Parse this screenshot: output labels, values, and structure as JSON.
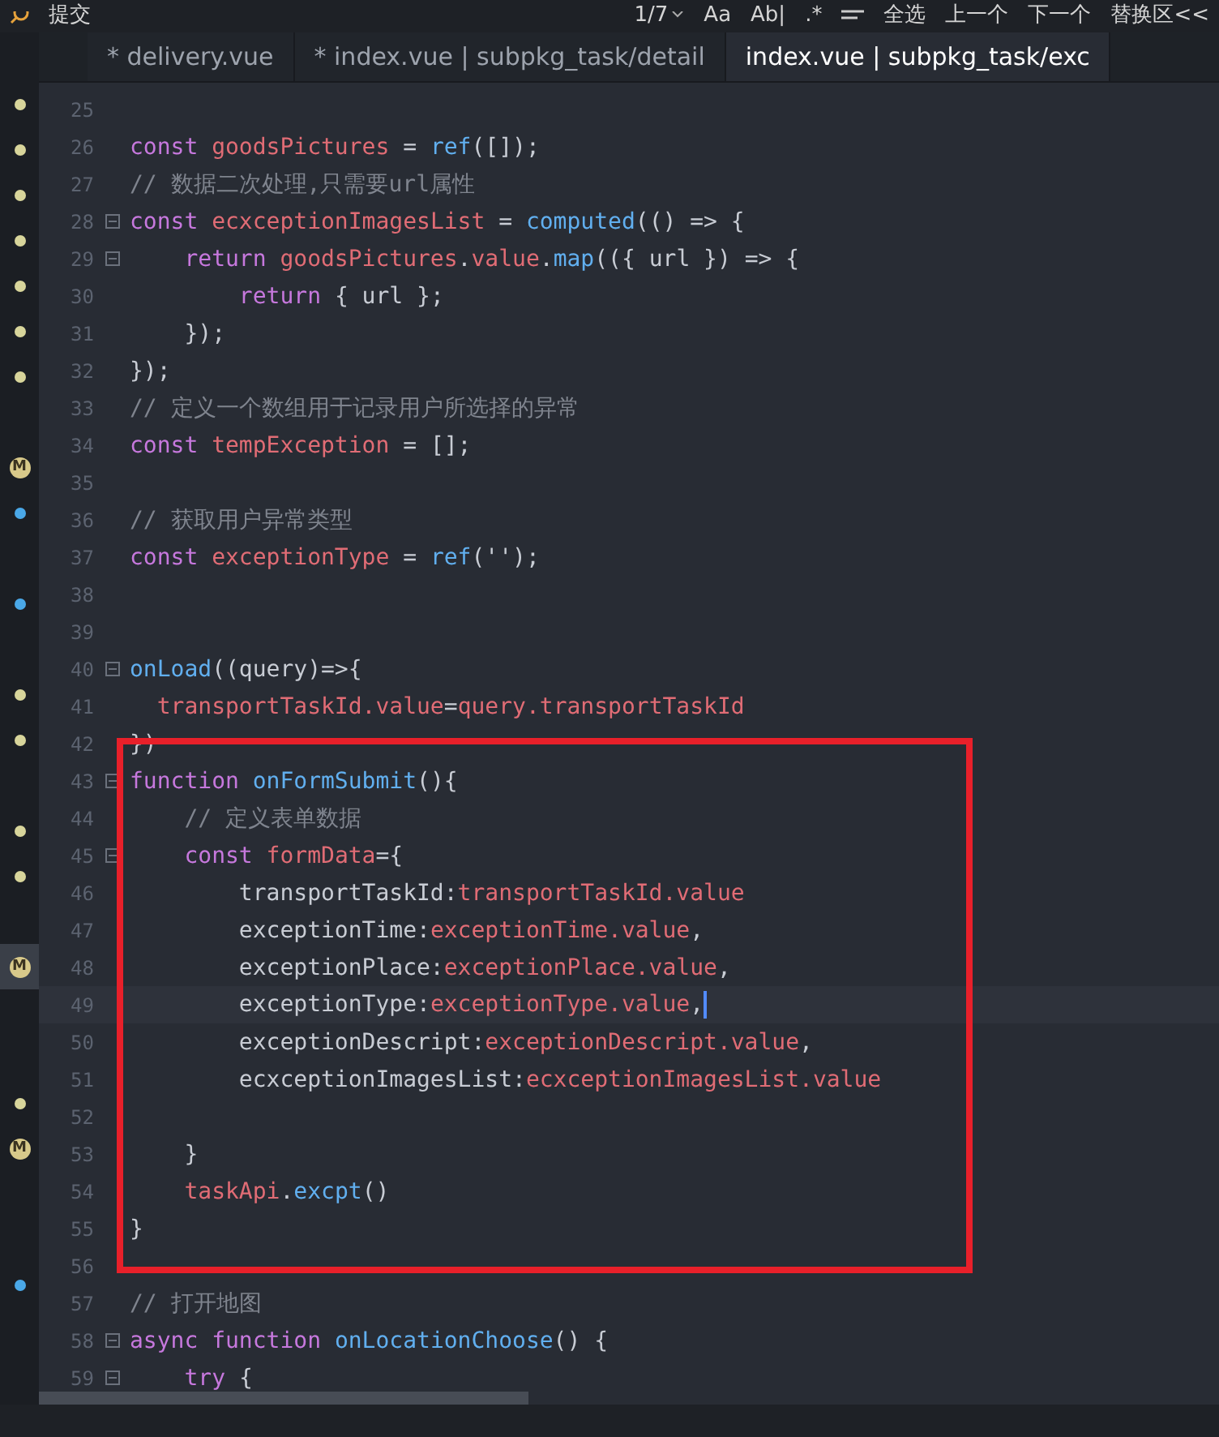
{
  "toolbar": {
    "items": [
      {
        "kind": "icon"
      },
      {
        "kind": "label",
        "text": "提交"
      },
      {
        "kind": "spacer"
      },
      {
        "kind": "label",
        "text": "1/7"
      },
      {
        "kind": "caret"
      },
      {
        "kind": "label",
        "text": "Aa"
      },
      {
        "kind": "label",
        "text": "Ab|"
      },
      {
        "kind": "label",
        "text": ".*"
      },
      {
        "kind": "menu"
      },
      {
        "kind": "label",
        "text": "全选"
      },
      {
        "kind": "label",
        "text": "上一个"
      },
      {
        "kind": "label",
        "text": "下一个"
      },
      {
        "kind": "label",
        "text": "替换区<<"
      }
    ]
  },
  "overview_markers": [
    {
      "kind": "dot",
      "color": "#d8d59b"
    },
    {
      "kind": "dot",
      "color": "#d8d59b"
    },
    {
      "kind": "dot",
      "color": "#d8d59b"
    },
    {
      "kind": "dot",
      "color": "#d8d59b"
    },
    {
      "kind": "dot",
      "color": "#d8d59b"
    },
    {
      "kind": "dot",
      "color": "#d8d59b"
    },
    {
      "kind": "dot",
      "color": "#d8d59b"
    },
    {
      "kind": "empty"
    },
    {
      "kind": "badge",
      "label": "M"
    },
    {
      "kind": "dot",
      "color": "#4aa8e8"
    },
    {
      "kind": "empty"
    },
    {
      "kind": "dot",
      "color": "#4aa8e8"
    },
    {
      "kind": "empty"
    },
    {
      "kind": "dot",
      "color": "#d8d59b"
    },
    {
      "kind": "dot",
      "color": "#d8d59b"
    },
    {
      "kind": "empty"
    },
    {
      "kind": "dot",
      "color": "#d8d59b"
    },
    {
      "kind": "dot",
      "color": "#d8d59b"
    },
    {
      "kind": "empty"
    },
    {
      "kind": "highlighted-badge",
      "label": "M"
    },
    {
      "kind": "empty"
    },
    {
      "kind": "empty"
    },
    {
      "kind": "dot",
      "color": "#d8d59b"
    },
    {
      "kind": "badge",
      "label": "M"
    },
    {
      "kind": "empty"
    },
    {
      "kind": "empty"
    },
    {
      "kind": "dot",
      "color": "#4aa8e8"
    }
  ],
  "tabs": [
    {
      "label": "* delivery.vue",
      "selected": false
    },
    {
      "label": "* index.vue | subpkg_task/detail",
      "selected": false
    },
    {
      "label": "index.vue | subpkg_task/exc",
      "selected": true
    }
  ],
  "editor": {
    "lines": [
      {
        "number": "25",
        "fold": false,
        "current": false
      },
      {
        "number": "26",
        "fold": false,
        "current": false,
        "tokens": [
          {
            "kind": "keyword",
            "text": "const "
          },
          {
            "kind": "var",
            "text": "goodsPictures"
          },
          {
            "kind": "plain",
            "text": " = "
          },
          {
            "kind": "func",
            "text": "ref"
          },
          {
            "kind": "plain",
            "text": "([]);"
          }
        ]
      },
      {
        "number": "27",
        "fold": false,
        "current": false,
        "tokens": [
          {
            "kind": "comment",
            "text": "// 数据二次处理,只需要url属性"
          }
        ]
      },
      {
        "number": "28",
        "fold": true,
        "current": false,
        "tokens": [
          {
            "kind": "keyword",
            "text": "const "
          },
          {
            "kind": "var",
            "text": "ecxceptionImagesList"
          },
          {
            "kind": "plain",
            "text": " = "
          },
          {
            "kind": "func",
            "text": "computed"
          },
          {
            "kind": "plain",
            "text": "(() => {"
          }
        ]
      },
      {
        "number": "29",
        "fold": true,
        "current": false,
        "tokens": [
          {
            "kind": "keyword",
            "text": "    return "
          },
          {
            "kind": "var",
            "text": "goodsPictures"
          },
          {
            "kind": "plain",
            "text": "."
          },
          {
            "kind": "var",
            "text": "value"
          },
          {
            "kind": "plain",
            "text": "."
          },
          {
            "kind": "func",
            "text": "map"
          },
          {
            "kind": "plain",
            "text": "(({ url }) => {"
          }
        ]
      },
      {
        "number": "30",
        "fold": false,
        "current": false,
        "tokens": [
          {
            "kind": "keyword",
            "text": "        return "
          },
          {
            "kind": "plain",
            "text": "{ url };"
          }
        ]
      },
      {
        "number": "31",
        "fold": false,
        "current": false,
        "tokens": [
          {
            "kind": "plain",
            "text": "    });"
          }
        ]
      },
      {
        "number": "32",
        "fold": false,
        "current": false,
        "tokens": [
          {
            "kind": "plain",
            "text": "});"
          }
        ]
      },
      {
        "number": "33",
        "fold": false,
        "current": false,
        "tokens": [
          {
            "kind": "comment",
            "text": "// 定义一个数组用于记录用户所选择的异常"
          }
        ]
      },
      {
        "number": "34",
        "fold": false,
        "current": false,
        "tokens": [
          {
            "kind": "keyword",
            "text": "const "
          },
          {
            "kind": "var",
            "text": "tempException"
          },
          {
            "kind": "plain",
            "text": " = [];"
          }
        ]
      },
      {
        "number": "35",
        "fold": false,
        "current": false
      },
      {
        "number": "36",
        "fold": false,
        "current": false,
        "tokens": [
          {
            "kind": "comment",
            "text": "// 获取用户异常类型"
          }
        ]
      },
      {
        "number": "37",
        "fold": false,
        "current": false,
        "tokens": [
          {
            "kind": "keyword",
            "text": "const "
          },
          {
            "kind": "var",
            "text": "exceptionType"
          },
          {
            "kind": "plain",
            "text": " = "
          },
          {
            "kind": "func",
            "text": "ref"
          },
          {
            "kind": "plain",
            "text": "('');"
          }
        ]
      },
      {
        "number": "38",
        "fold": false,
        "current": false
      },
      {
        "number": "39",
        "fold": false,
        "current": false
      },
      {
        "number": "40",
        "fold": true,
        "current": false,
        "tokens": [
          {
            "kind": "func",
            "text": "onLoad"
          },
          {
            "kind": "plain",
            "text": "((query)=>{"
          }
        ]
      },
      {
        "number": "41",
        "fold": false,
        "current": false,
        "tokens": [
          {
            "kind": "var",
            "text": "  transportTaskId.value"
          },
          {
            "kind": "plain",
            "text": "="
          },
          {
            "kind": "var",
            "text": "query.transportTaskId"
          }
        ]
      },
      {
        "number": "42",
        "fold": false,
        "current": false,
        "tokens": [
          {
            "kind": "plain",
            "text": "})"
          }
        ]
      },
      {
        "number": "43",
        "fold": true,
        "current": false,
        "tokens": [
          {
            "kind": "keyword",
            "text": "function "
          },
          {
            "kind": "func",
            "text": "onFormSubmit"
          },
          {
            "kind": "plain",
            "text": "(){"
          }
        ]
      },
      {
        "number": "44",
        "fold": false,
        "current": false,
        "tokens": [
          {
            "kind": "comment",
            "text": "    // 定义表单数据"
          }
        ]
      },
      {
        "number": "45",
        "fold": true,
        "current": false,
        "tokens": [
          {
            "kind": "keyword",
            "text": "    const "
          },
          {
            "kind": "var",
            "text": "formData"
          },
          {
            "kind": "plain",
            "text": "={"
          }
        ]
      },
      {
        "number": "46",
        "fold": false,
        "current": false,
        "tokens": [
          {
            "kind": "plain",
            "text": "        transportTaskId:"
          },
          {
            "kind": "var",
            "text": "transportTaskId.value"
          }
        ]
      },
      {
        "number": "47",
        "fold": false,
        "current": false,
        "tokens": [
          {
            "kind": "plain",
            "text": "        exceptionTime:"
          },
          {
            "kind": "var",
            "text": "exceptionTime.value"
          },
          {
            "kind": "plain",
            "text": ","
          }
        ]
      },
      {
        "number": "48",
        "fold": false,
        "current": false,
        "tokens": [
          {
            "kind": "plain",
            "text": "        exceptionPlace:"
          },
          {
            "kind": "var",
            "text": "exceptionPlace.value"
          },
          {
            "kind": "plain",
            "text": ","
          }
        ]
      },
      {
        "number": "49",
        "fold": false,
        "current": true,
        "tokens": [
          {
            "kind": "plain",
            "text": "        exceptionType:"
          },
          {
            "kind": "var",
            "text": "exceptionType.value"
          },
          {
            "kind": "plain",
            "text": ","
          }
        ]
      },
      {
        "number": "50",
        "fold": false,
        "current": false,
        "tokens": [
          {
            "kind": "plain",
            "text": "        exceptionDescript:"
          },
          {
            "kind": "var",
            "text": "exceptionDescript.value"
          },
          {
            "kind": "plain",
            "text": ","
          }
        ]
      },
      {
        "number": "51",
        "fold": false,
        "current": false,
        "tokens": [
          {
            "kind": "plain",
            "text": "        ecxceptionImagesList:"
          },
          {
            "kind": "var",
            "text": "ecxceptionImagesList.value"
          }
        ]
      },
      {
        "number": "52",
        "fold": false,
        "current": false
      },
      {
        "number": "53",
        "fold": false,
        "current": false,
        "tokens": [
          {
            "kind": "plain",
            "text": "    }"
          }
        ]
      },
      {
        "number": "54",
        "fold": false,
        "current": false,
        "tokens": [
          {
            "kind": "var",
            "text": "    taskApi"
          },
          {
            "kind": "plain",
            "text": "."
          },
          {
            "kind": "func",
            "text": "excpt"
          },
          {
            "kind": "plain",
            "text": "()"
          }
        ]
      },
      {
        "number": "55",
        "fold": false,
        "current": false,
        "tokens": [
          {
            "kind": "plain",
            "text": "}"
          }
        ]
      },
      {
        "number": "56",
        "fold": false,
        "current": false
      },
      {
        "number": "57",
        "fold": false,
        "current": false,
        "tokens": [
          {
            "kind": "comment",
            "text": "// 打开地图"
          }
        ]
      },
      {
        "number": "58",
        "fold": true,
        "current": false,
        "tokens": [
          {
            "kind": "keyword",
            "text": "async function "
          },
          {
            "kind": "func",
            "text": "onLocationChoose"
          },
          {
            "kind": "plain",
            "text": "() {"
          }
        ]
      },
      {
        "number": "59",
        "fold": true,
        "current": false,
        "tokens": [
          {
            "kind": "keyword",
            "text": "    try "
          },
          {
            "kind": "plain",
            "text": "{"
          }
        ]
      }
    ]
  }
}
